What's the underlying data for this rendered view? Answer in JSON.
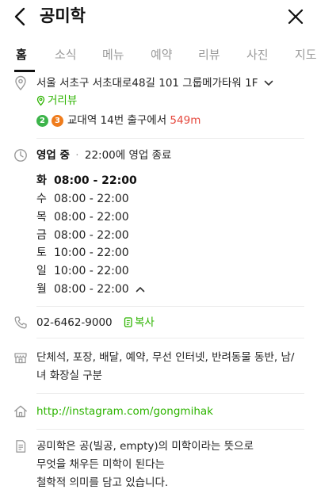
{
  "header": {
    "title": "공미학"
  },
  "tabs": [
    {
      "label": "홈",
      "active": true
    },
    {
      "label": "소식"
    },
    {
      "label": "메뉴"
    },
    {
      "label": "예약"
    },
    {
      "label": "리뷰"
    },
    {
      "label": "사진"
    },
    {
      "label": "지도"
    }
  ],
  "address": {
    "text": "서울 서초구 서초대로48길 101 그룹메가타워 1F",
    "street_view": "거리뷰",
    "subway": {
      "lines": [
        {
          "number": "2",
          "color": "#3cb44a"
        },
        {
          "number": "3",
          "color": "#ef7c1c"
        }
      ],
      "station_text": "교대역 14번 출구에서",
      "distance": "549m"
    }
  },
  "hours": {
    "status": "영업 중",
    "status_detail": "22:00에 영업 종료",
    "days": [
      {
        "day": "화",
        "time": "08:00 - 22:00",
        "today": true
      },
      {
        "day": "수",
        "time": "08:00 - 22:00"
      },
      {
        "day": "목",
        "time": "08:00 - 22:00"
      },
      {
        "day": "금",
        "time": "08:00 - 22:00"
      },
      {
        "day": "토",
        "time": "10:00 - 22:00"
      },
      {
        "day": "일",
        "time": "10:00 - 22:00"
      },
      {
        "day": "월",
        "time": "08:00 - 22:00"
      }
    ]
  },
  "phone": {
    "number": "02-6462-9000",
    "copy_label": "복사"
  },
  "facilities": {
    "line1": "단체석, 포장, 배달, 예약, 무선 인터넷, 반려동물 동반, 남/",
    "line2": "녀 화장실 구분"
  },
  "website": {
    "url": "http://instagram.com/gongmihak"
  },
  "description": {
    "line1": "공미학은 공(빌공, empty)의 미학이라는 뜻으로",
    "line2": "무엇을 채우든 미학이 된다는",
    "line3": "철학적 의미를 담고 있습니다."
  },
  "colors": {
    "accent_green": "#2db400",
    "distance_red": "#e5473c"
  }
}
